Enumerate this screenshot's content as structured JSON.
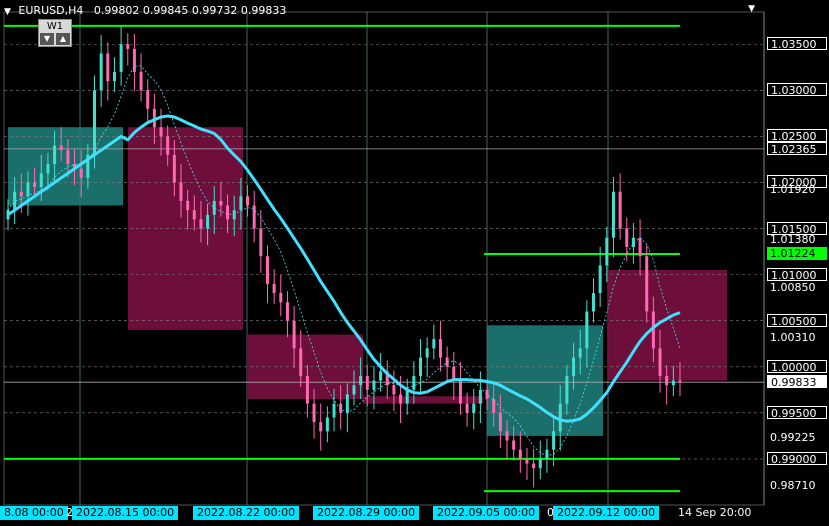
{
  "header": {
    "symbol": "EURUSD,H4",
    "open": "0.99802",
    "high": "0.99845",
    "low": "0.99732",
    "close": "0.99833"
  },
  "timeframe_widget": {
    "label": "W1"
  },
  "colors": {
    "background": "#000000",
    "bull_candle": "#40e0d0",
    "bear_candle": "#ff69b4",
    "ma_line": "#40e0ff",
    "level_line": "#00ff00",
    "bull_zone": "#1e7b76",
    "bear_zone": "#7a1040",
    "grid": "#808080",
    "time_label_bg": "#00e5ff"
  },
  "price_scale": {
    "min": 0.985,
    "max": 1.0385,
    "labels": [
      {
        "text": "1.03500",
        "value": 1.035,
        "style": "boxed"
      },
      {
        "text": "1.03000",
        "value": 1.03,
        "style": "boxed"
      },
      {
        "text": "1.02500",
        "value": 1.025,
        "style": "boxed"
      },
      {
        "text": "1.02365",
        "value": 1.02365,
        "style": "boxed"
      },
      {
        "text": "1.02000",
        "value": 1.02,
        "style": "boxed"
      },
      {
        "text": "1.01920",
        "value": 1.0192,
        "style": "plain"
      },
      {
        "text": "1.01500",
        "value": 1.015,
        "style": "boxed"
      },
      {
        "text": "1.01380",
        "value": 1.0138,
        "style": "plain"
      },
      {
        "text": "1.01224",
        "value": 1.01224,
        "style": "green"
      },
      {
        "text": "1.01000",
        "value": 1.01,
        "style": "boxed"
      },
      {
        "text": "1.00850",
        "value": 1.0085,
        "style": "plain"
      },
      {
        "text": "1.00500",
        "value": 1.005,
        "style": "boxed"
      },
      {
        "text": "1.00310",
        "value": 1.0031,
        "style": "plain"
      },
      {
        "text": "1.00000",
        "value": 1.0,
        "style": "boxed"
      },
      {
        "text": "0.99833",
        "value": 0.99833,
        "style": "current"
      },
      {
        "text": "0.99500",
        "value": 0.995,
        "style": "boxed"
      },
      {
        "text": "0.99225",
        "value": 0.99225,
        "style": "plain"
      },
      {
        "text": "0.99000",
        "value": 0.99,
        "style": "boxed"
      },
      {
        "text": "0.98710",
        "value": 0.9871,
        "style": "plain"
      }
    ],
    "grid_values": [
      1.035,
      1.03,
      1.025,
      1.02,
      1.015,
      1.01,
      1.005,
      1.0,
      0.995,
      0.99
    ]
  },
  "time_labels": [
    {
      "text": "8.08 00:00",
      "style": "cyan"
    },
    {
      "text": "2",
      "style": "plain"
    },
    {
      "text": "2022.08.15 00:00",
      "style": "cyan"
    },
    {
      "text": "2022.08.22 00:00",
      "style": "cyan"
    },
    {
      "text": "2022.08.29 00:00",
      "style": "cyan"
    },
    {
      "text": "2022.09.05 00:00",
      "style": "cyan"
    },
    {
      "text": "0",
      "style": "plain"
    },
    {
      "text": "2022.09.12 00:00",
      "style": "cyan"
    },
    {
      "text": "14 Sep 20:00",
      "style": "plain"
    }
  ],
  "levels": {
    "horizontal_green": [
      1.037,
      1.01224,
      0.99,
      0.9865
    ],
    "horizontal_gray": [
      1.02365,
      0.99833
    ]
  },
  "zones": [
    {
      "type": "bull",
      "from": "2022.08.08",
      "to": "2022.08.12",
      "top": 1.026,
      "bottom": 1.0175
    },
    {
      "type": "bear",
      "from": "2022.08.15",
      "to": "2022.08.19",
      "top": 1.026,
      "bottom": 1.004
    },
    {
      "type": "bear",
      "from": "2022.08.22",
      "to": "2022.08.26",
      "top": 1.0035,
      "bottom": 0.9965
    },
    {
      "type": "bear",
      "from": "2022.08.29",
      "to": "2022.09.02",
      "top": 0.9968,
      "bottom": 0.996
    },
    {
      "type": "bull",
      "from": "2022.09.05",
      "to": "2022.09.09",
      "top": 1.0045,
      "bottom": 0.9925
    },
    {
      "type": "bear",
      "from": "2022.09.12",
      "to": "2022.09.16",
      "top": 1.0105,
      "bottom": 0.9985
    }
  ],
  "series": {
    "close": [
      1.017,
      1.019,
      1.0185,
      1.02,
      1.0195,
      1.021,
      1.022,
      1.024,
      1.0235,
      1.022,
      1.0215,
      1.0205,
      1.023,
      1.03,
      1.034,
      1.031,
      1.032,
      1.035,
      1.0345,
      1.032,
      1.03,
      1.028,
      1.026,
      1.025,
      1.023,
      1.02,
      1.018,
      1.017,
      1.016,
      1.015,
      1.0165,
      1.018,
      1.0175,
      1.016,
      1.017,
      1.0185,
      1.0175,
      1.015,
      1.012,
      1.009,
      1.008,
      1.007,
      1.005,
      1.002,
      0.999,
      0.996,
      0.994,
      0.993,
      0.9945,
      0.996,
      0.995,
      0.997,
      0.998,
      0.999,
      0.9975,
      0.9985,
      0.9995,
      0.998,
      0.997,
      0.996,
      0.9975,
      0.999,
      1.001,
      1.002,
      1.003,
      1.001,
      1.0,
      0.9985,
      0.996,
      0.995,
      0.996,
      0.9975,
      0.9965,
      0.995,
      0.993,
      0.992,
      0.991,
      0.99,
      0.9895,
      0.989,
      0.99,
      0.991,
      0.993,
      0.996,
      0.999,
      1.001,
      1.002,
      1.006,
      1.008,
      1.011,
      1.014,
      1.019,
      1.015,
      1.013,
      1.014,
      1.012,
      1.006,
      1.002,
      0.999,
      0.998,
      0.9985,
      0.9983
    ]
  }
}
